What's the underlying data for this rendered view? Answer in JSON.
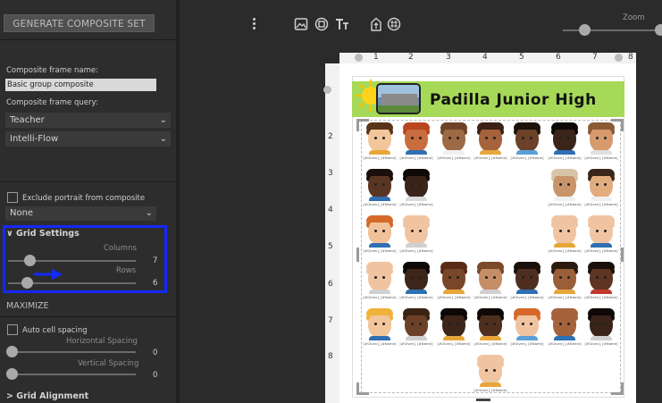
{
  "toolbar": {
    "generate_label": "GENERATE COMPOSITE SET",
    "zoom_label": "Zoom"
  },
  "left_panel": {
    "frame_name_label": "Composite frame name:",
    "frame_name_value": "Basic group composite",
    "frame_query_label": "Composite frame query:",
    "query_dropdown_1": "Teacher",
    "query_dropdown_2": "Intelli-Flow",
    "exclude_label": "Exclude portrait from composite",
    "exclude_dropdown": "None",
    "grid_settings": {
      "title": "Grid Settings",
      "columns_label": "Columns",
      "columns_value": "7",
      "columns_min": 1,
      "columns_max": 30,
      "rows_label": "Rows",
      "rows_value": "6",
      "rows_min": 1,
      "rows_max": 30
    },
    "maximize_title": "MAXIMIZE",
    "auto_spacing_label": "Auto cell spacing",
    "h_spacing_label": "Horizontal Spacing",
    "h_spacing_value": "0",
    "v_spacing_label": "Vertical Spacing",
    "v_spacing_value": "0",
    "grid_alignment_title": "Grid Alignment"
  },
  "ruler": {
    "top": [
      "1",
      "2",
      "3",
      "4",
      "5",
      "6",
      "7",
      "8"
    ],
    "left": [
      "2",
      "3",
      "4",
      "5",
      "6",
      "7",
      "8"
    ]
  },
  "document": {
    "school_name": "Padilla Junior High",
    "caption": "[#Given], [#Name]"
  },
  "colors": {
    "banner": "#a6d957",
    "highlight_box": "#1428ff",
    "panel_bg": "#2d2d2d"
  }
}
